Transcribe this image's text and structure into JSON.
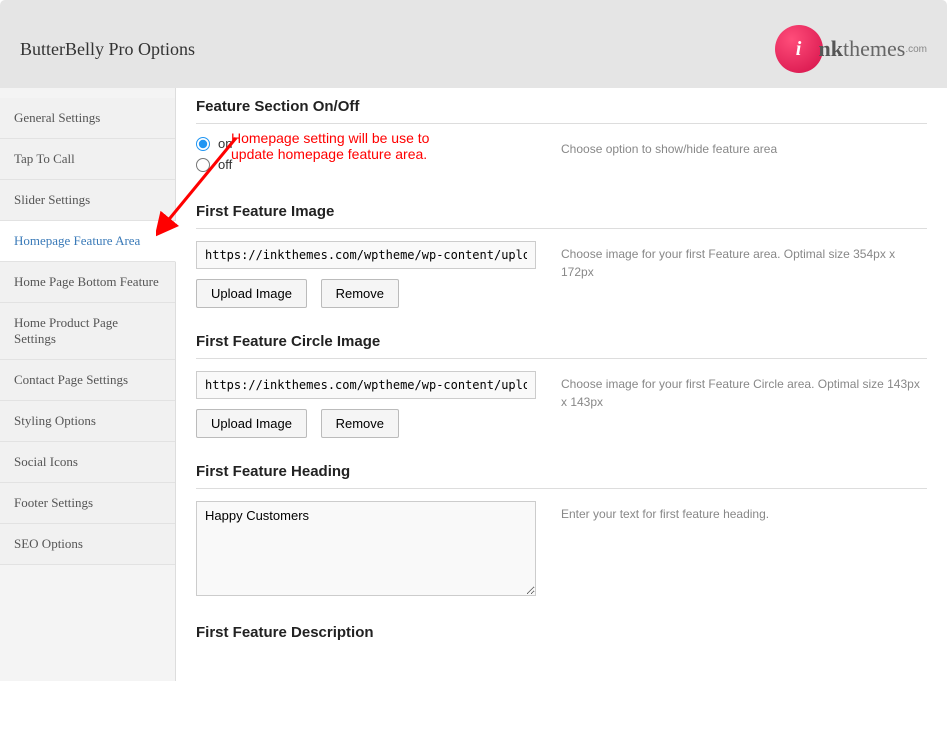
{
  "header": {
    "title": "ButterBelly Pro Options",
    "logo_text1": "nk",
    "logo_text2": "themes",
    "logo_com": ".com",
    "logo_initial": "i"
  },
  "sidebar": {
    "items": [
      {
        "label": "General Settings"
      },
      {
        "label": "Tap To Call"
      },
      {
        "label": "Slider Settings"
      },
      {
        "label": "Homepage Feature Area"
      },
      {
        "label": "Home Page Bottom Feature"
      },
      {
        "label": "Home Product Page Settings"
      },
      {
        "label": "Contact Page Settings"
      },
      {
        "label": "Styling Options"
      },
      {
        "label": "Social Icons"
      },
      {
        "label": "Footer Settings"
      },
      {
        "label": "SEO Options"
      }
    ],
    "active_index": 3
  },
  "sections": {
    "feature_toggle": {
      "heading": "Feature Section On/Off",
      "option_on": "on",
      "option_off": "off",
      "selected": "on",
      "help": "Choose option to show/hide feature area"
    },
    "first_image": {
      "heading": "First Feature Image",
      "value": "https://inkthemes.com/wptheme/wp-content/uploads/s",
      "upload_label": "Upload Image",
      "remove_label": "Remove",
      "help": "Choose image for your first Feature area. Optimal size 354px x 172px"
    },
    "first_circle": {
      "heading": "First Feature Circle Image",
      "value": "https://inkthemes.com/wptheme/wp-content/uploads/s",
      "upload_label": "Upload Image",
      "remove_label": "Remove",
      "help": "Choose image for your first Feature Circle area. Optimal size 143px x 143px"
    },
    "first_heading": {
      "heading": "First Feature Heading",
      "value": "Happy Customers",
      "help": "Enter your text for first feature heading."
    },
    "first_desc": {
      "heading": "First Feature Description"
    }
  },
  "annotation": {
    "line1": "Homepage setting will be use to",
    "line2": "update homepage feature area."
  }
}
